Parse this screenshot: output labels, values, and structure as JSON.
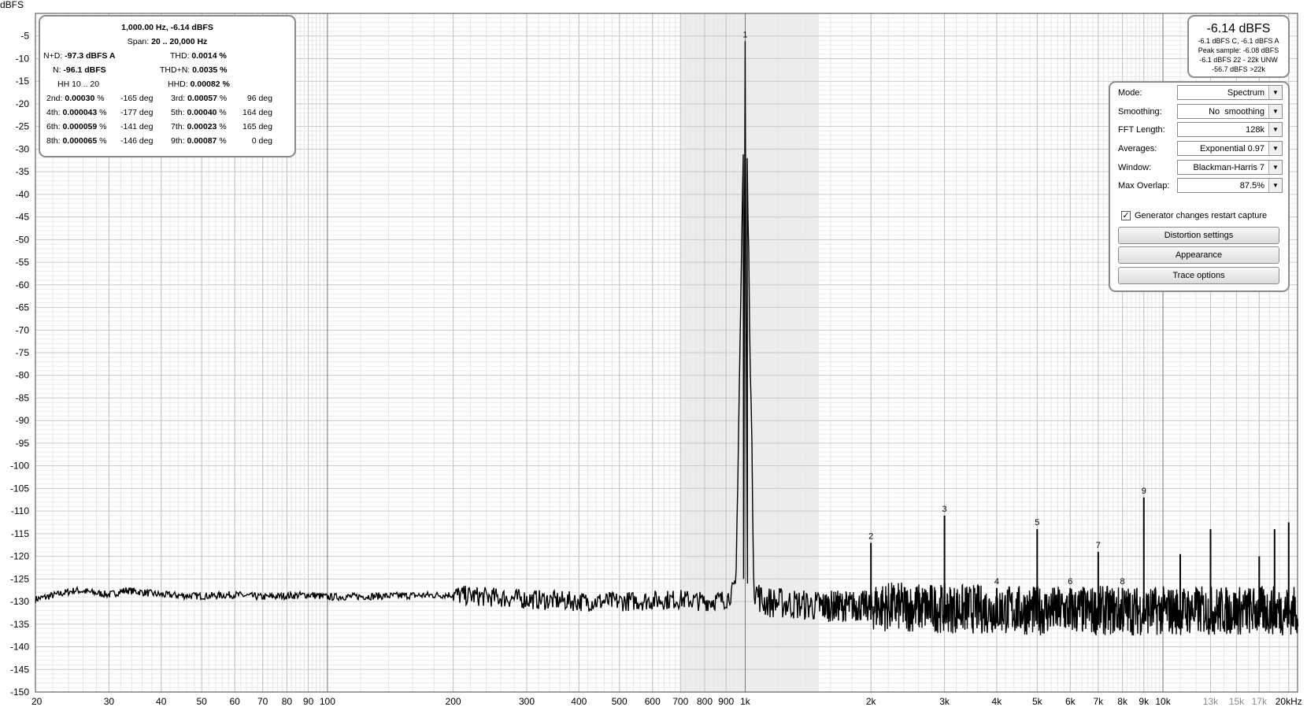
{
  "chart_data": {
    "type": "line",
    "ylabel": "dBFS",
    "xlabel": "",
    "x_scale": "log",
    "xlim": [
      20,
      21000
    ],
    "ylim": [
      -150,
      0
    ],
    "grid": true,
    "y_ticks": [
      -5,
      -10,
      -15,
      -20,
      -25,
      -30,
      -35,
      -40,
      -45,
      -50,
      -55,
      -60,
      -65,
      -70,
      -75,
      -80,
      -85,
      -90,
      -95,
      -100,
      -105,
      -110,
      -115,
      -120,
      -125,
      -130,
      -135,
      -140,
      -145,
      -150
    ],
    "x_ticks": [
      {
        "f": 20,
        "label": "20"
      },
      {
        "f": 30,
        "label": "30"
      },
      {
        "f": 40,
        "label": "40"
      },
      {
        "f": 50,
        "label": "50"
      },
      {
        "f": 60,
        "label": "60"
      },
      {
        "f": 70,
        "label": "70"
      },
      {
        "f": 80,
        "label": "80"
      },
      {
        "f": 90,
        "label": "90"
      },
      {
        "f": 100,
        "label": "100"
      },
      {
        "f": 200,
        "label": "200"
      },
      {
        "f": 300,
        "label": "300"
      },
      {
        "f": 400,
        "label": "400"
      },
      {
        "f": 500,
        "label": "500"
      },
      {
        "f": 600,
        "label": "600"
      },
      {
        "f": 700,
        "label": "700"
      },
      {
        "f": 800,
        "label": "800"
      },
      {
        "f": 900,
        "label": "900"
      },
      {
        "f": 1000,
        "label": "1k"
      },
      {
        "f": 2000,
        "label": "2k"
      },
      {
        "f": 3000,
        "label": "3k"
      },
      {
        "f": 4000,
        "label": "4k"
      },
      {
        "f": 5000,
        "label": "5k"
      },
      {
        "f": 6000,
        "label": "6k"
      },
      {
        "f": 7000,
        "label": "7k"
      },
      {
        "f": 8000,
        "label": "8k"
      },
      {
        "f": 9000,
        "label": "9k"
      },
      {
        "f": 10000,
        "label": "10k"
      },
      {
        "f": 13000,
        "label": "13k",
        "faint": true
      },
      {
        "f": 15000,
        "label": "15k",
        "faint": true
      },
      {
        "f": 17000,
        "label": "17k",
        "faint": true
      },
      {
        "f": 20000,
        "label": "20kHz"
      }
    ],
    "highlight_band": [
      700,
      1500
    ],
    "noise_floor": [
      [
        20,
        -129.5
      ],
      [
        25,
        -127.5
      ],
      [
        30,
        -128.5
      ],
      [
        33,
        -127.5
      ],
      [
        40,
        -128.5
      ],
      [
        50,
        -128.8
      ],
      [
        60,
        -128.5
      ],
      [
        70,
        -129
      ],
      [
        90,
        -128.5
      ],
      [
        100,
        -129
      ],
      [
        200,
        -128.5
      ],
      [
        300,
        -129.5
      ],
      [
        400,
        -130
      ],
      [
        500,
        -130
      ],
      [
        700,
        -129.5
      ],
      [
        800,
        -130
      ],
      [
        900,
        -129.5
      ],
      [
        950,
        -127
      ],
      [
        1000,
        -6.14
      ],
      [
        1050,
        -127
      ],
      [
        1100,
        -130
      ],
      [
        1500,
        -131
      ],
      [
        2000,
        -131
      ],
      [
        3000,
        -131.5
      ],
      [
        5000,
        -132
      ],
      [
        10000,
        -132
      ],
      [
        20000,
        -132
      ]
    ],
    "harmonics": [
      {
        "n": "1",
        "f": 1000,
        "db": -6.14
      },
      {
        "n": "2",
        "f": 2000,
        "db": -117
      },
      {
        "n": "3",
        "f": 3000,
        "db": -111
      },
      {
        "n": "4",
        "f": 4000,
        "db": -127
      },
      {
        "n": "5",
        "f": 5000,
        "db": -114
      },
      {
        "n": "6",
        "f": 6000,
        "db": -127
      },
      {
        "n": "7",
        "f": 7000,
        "db": -119
      },
      {
        "n": "8",
        "f": 8000,
        "db": -127
      },
      {
        "n": "9",
        "f": 9000,
        "db": -107
      }
    ],
    "spurs": [
      {
        "f": 11000,
        "db": -119.5
      },
      {
        "f": 13000,
        "db": -114
      },
      {
        "f": 17000,
        "db": -120
      },
      {
        "f": 18500,
        "db": -114
      },
      {
        "f": 20000,
        "db": -112.5
      }
    ]
  },
  "stats": {
    "header": "1,000.00 Hz, -6.14 dBFS",
    "span_label": "Span:",
    "span_value": "20 .. 20,000 Hz",
    "nd_label": "N+D:",
    "nd_value": "-97.3 dBFS A",
    "n_label": "N:",
    "n_value": "-96.1 dBFS",
    "hh": "HH 10 .. 20",
    "thd_label": "THD:",
    "thd_value": "0.0014 %",
    "thdn_label": "THD+N:",
    "thdn_value": "0.0035 %",
    "hhd_label": "HHD:",
    "hhd_value": "0.00082 %",
    "harm": [
      {
        "l": "2nd:",
        "v": "0.00030 %",
        "d": "-165 deg",
        "l2": "3rd:",
        "v2": "0.00057 %",
        "d2": "96 deg"
      },
      {
        "l": "4th:",
        "v": "0.000043 %",
        "d": "-177 deg",
        "l2": "5th:",
        "v2": "0.00040 %",
        "d2": "164 deg"
      },
      {
        "l": "6th:",
        "v": "0.000059 %",
        "d": "-141 deg",
        "l2": "7th:",
        "v2": "0.00023 %",
        "d2": "165 deg"
      },
      {
        "l": "8th:",
        "v": "0.000065 %",
        "d": "-146 deg",
        "l2": "9th:",
        "v2": "0.00087 %",
        "d2": "0 deg"
      }
    ]
  },
  "peak": {
    "value": "-6.14 dBFS",
    "line1": "-6.1 dBFS C, -6.1 dBFS A",
    "line2": "Peak sample: -6.08 dBFS",
    "line3": "-6.1 dBFS 22 - 22k UNW",
    "line4": "-56.7 dBFS >22k"
  },
  "controls": {
    "mode_label": "Mode:",
    "mode_value": "Spectrum",
    "smoothing_label": "Smoothing:",
    "smoothing_value": "No  smoothing",
    "fft_label": "FFT Length:",
    "fft_value": "128k",
    "avg_label": "Averages:",
    "avg_value": "Exponential 0.97",
    "window_label": "Window:",
    "window_value": "Blackman-Harris 7",
    "overlap_label": "Max Overlap:",
    "overlap_value": "87.5%",
    "restart_label": "Generator changes restart capture",
    "restart_checked": true,
    "distortion_btn": "Distortion settings",
    "appearance_btn": "Appearance",
    "trace_btn": "Trace options"
  }
}
